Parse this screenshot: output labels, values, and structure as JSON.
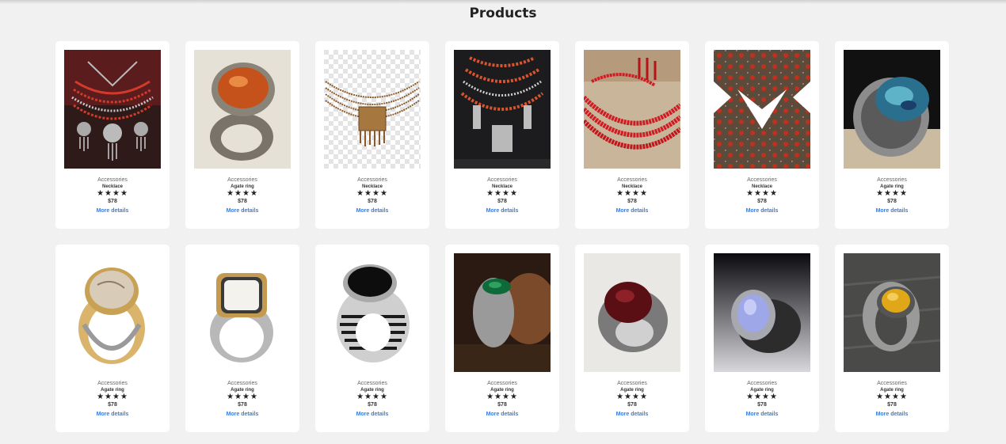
{
  "page": {
    "title": "Products"
  },
  "colors": {
    "background": "#f1f1f1",
    "card": "#ffffff",
    "link": "#3b7ddd"
  },
  "products": [
    {
      "category": "Accessories",
      "name": "Necklace",
      "rating": 4,
      "stars": "★★★★",
      "price": "$78",
      "link": "More details",
      "image": "red-beaded-necklace-with-pendants"
    },
    {
      "category": "Accessories",
      "name": "Agate ring",
      "rating": 4,
      "stars": "★★★★",
      "price": "$78",
      "link": "More details",
      "image": "orange-agate-silver-ring"
    },
    {
      "category": "Accessories",
      "name": "Necklace",
      "rating": 4,
      "stars": "★★★★",
      "price": "$78",
      "link": "More details",
      "image": "bronze-multistrand-necklace"
    },
    {
      "category": "Accessories",
      "name": "Necklace",
      "rating": 4,
      "stars": "★★★★",
      "price": "$78",
      "link": "More details",
      "image": "coral-silver-necklace-set"
    },
    {
      "category": "Accessories",
      "name": "Necklace",
      "rating": 4,
      "stars": "★★★★",
      "price": "$78",
      "link": "More details",
      "image": "red-coral-bead-strands"
    },
    {
      "category": "Accessories",
      "name": "Necklace",
      "rating": 4,
      "stars": "★★★★",
      "price": "$78",
      "link": "More details",
      "image": "red-stone-ornate-necklace"
    },
    {
      "category": "Accessories",
      "name": "Agate ring",
      "rating": 4,
      "stars": "★★★★",
      "price": "$78",
      "link": "More details",
      "image": "abalone-silver-ring"
    },
    {
      "category": "Accessories",
      "name": "Agate ring",
      "rating": 4,
      "stars": "★★★★",
      "price": "$78",
      "link": "More details",
      "image": "gold-silver-agate-ring"
    },
    {
      "category": "Accessories",
      "name": "Agate ring",
      "rating": 4,
      "stars": "★★★★",
      "price": "$78",
      "link": "More details",
      "image": "white-stone-silver-ring"
    },
    {
      "category": "Accessories",
      "name": "Agate ring",
      "rating": 4,
      "stars": "★★★★",
      "price": "$78",
      "link": "More details",
      "image": "black-onyx-striped-ring"
    },
    {
      "category": "Accessories",
      "name": "Agate ring",
      "rating": 4,
      "stars": "★★★★",
      "price": "$78",
      "link": "More details",
      "image": "green-stone-ring"
    },
    {
      "category": "Accessories",
      "name": "Agate ring",
      "rating": 4,
      "stars": "★★★★",
      "price": "$78",
      "link": "More details",
      "image": "dark-red-agate-ring"
    },
    {
      "category": "Accessories",
      "name": "Agate ring",
      "rating": 4,
      "stars": "★★★★",
      "price": "$78",
      "link": "More details",
      "image": "blue-chalcedony-ring"
    },
    {
      "category": "Accessories",
      "name": "Agate ring",
      "rating": 4,
      "stars": "★★★★",
      "price": "$78",
      "link": "More details",
      "image": "yellow-agate-ring"
    }
  ]
}
